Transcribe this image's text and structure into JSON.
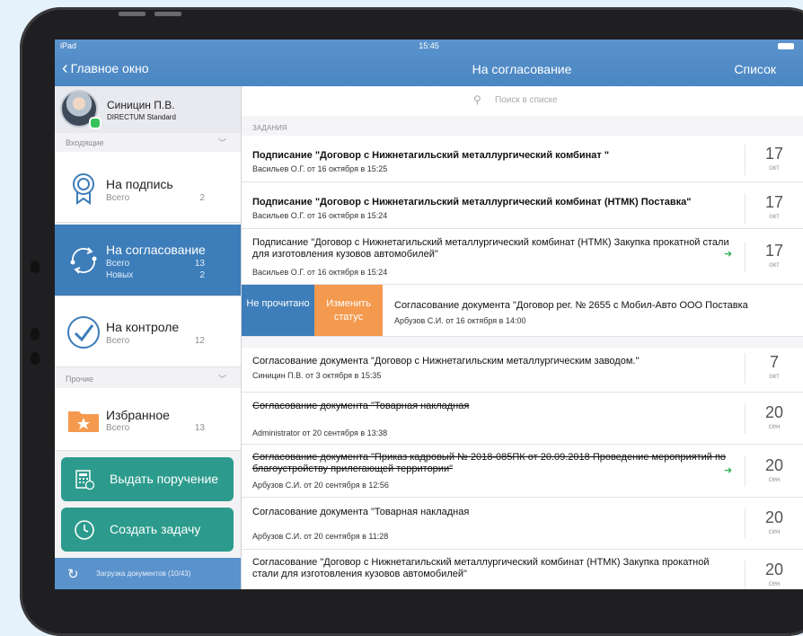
{
  "status": {
    "carrier": "iPad",
    "time": "15:45"
  },
  "nav": {
    "back": "Главное окно",
    "title": "На согласование",
    "right": "Список"
  },
  "user": {
    "name": "Синицин П.В.",
    "org": "DIRECTUM Standard"
  },
  "sidebar": {
    "incoming_label": "Входящие",
    "other_label": "Прочие",
    "items": [
      {
        "title": "На подпись",
        "rows": [
          {
            "k": "Всего",
            "v": "2"
          }
        ]
      },
      {
        "title": "На согласование",
        "rows": [
          {
            "k": "Всего",
            "v": "13"
          },
          {
            "k": "Новых",
            "v": "2"
          }
        ]
      },
      {
        "title": "На контроле",
        "rows": [
          {
            "k": "Всего",
            "v": "12"
          }
        ]
      },
      {
        "title": "Избранное",
        "rows": [
          {
            "k": "Всего",
            "v": "13"
          }
        ]
      }
    ],
    "actions": [
      {
        "label": "Выдать поручение",
        "icon": "calculator-icon"
      },
      {
        "label": "Создать задачу",
        "icon": "clock-icon"
      }
    ],
    "loading": "Загрузка документов (10/43)"
  },
  "main": {
    "search_placeholder": "Поиск в списке",
    "section": "ЗАДАНИЯ",
    "swipe": {
      "unread": "Не прочитано",
      "change": "Изменить статус"
    },
    "rows": [
      {
        "title": "Подписание \"Договор с Нижнетагильский металлургический комбинат \"",
        "sub": "Васильев О.Г. от 16 октября в 15:25",
        "day": "17",
        "month": "окт"
      },
      {
        "title": "Подписание \"Договор с Нижнетагильский металлургический комбинат (НТМК) Поставка\"",
        "sub": "Васильев О.Г. от 16 октября в 15:24",
        "day": "17",
        "month": "окт"
      },
      {
        "title": "Подписание \"Договор с Нижнетагильский металлургический комбинат (НТМК) Закупка прокатной стали для изготовления кузовов автомобилей\"",
        "sub": "Васильев О.Г. от 16 октября в 15:24",
        "day": "17",
        "month": "окт"
      },
      {
        "title": "Согласование документа \"Договор рег. № 2655 с Мобил-Авто ООО Поставка",
        "sub": "Арбузов С.И. от 16 октября в 14:00"
      },
      {
        "title": "Согласование документа \"Договор с Нижнетагильским металлургическим заводом.\"",
        "sub": "Синицин П.В. от 3 октября в 15:35",
        "day": "7",
        "month": "окт"
      },
      {
        "title": "Согласование документа \"Товарная накладная",
        "sub": "Administrator от 20 сентября в 13:38",
        "day": "20",
        "month": "сен"
      },
      {
        "title": "Согласование документа \"Приказ кадровый № 2018-085ПК от 20.09.2018 Проведение мероприятий по благоустройству прилегающей территории\"",
        "sub": "Арбузов С.И. от 20 сентября в 12:56",
        "day": "20",
        "month": "сен"
      },
      {
        "title": "Согласование документа \"Товарная накладная",
        "sub": "Арбузов С.И. от 20 сентября в 11:28",
        "day": "20",
        "month": "сен"
      },
      {
        "title": "Согласование \"Договор с Нижнетагильский металлургический комбинат (НТМК) Закупка прокатной стали для изготовления кузовов автомобилей\"",
        "sub": "",
        "day": "20",
        "month": "сен"
      }
    ],
    "forward_arrow": "➜"
  }
}
